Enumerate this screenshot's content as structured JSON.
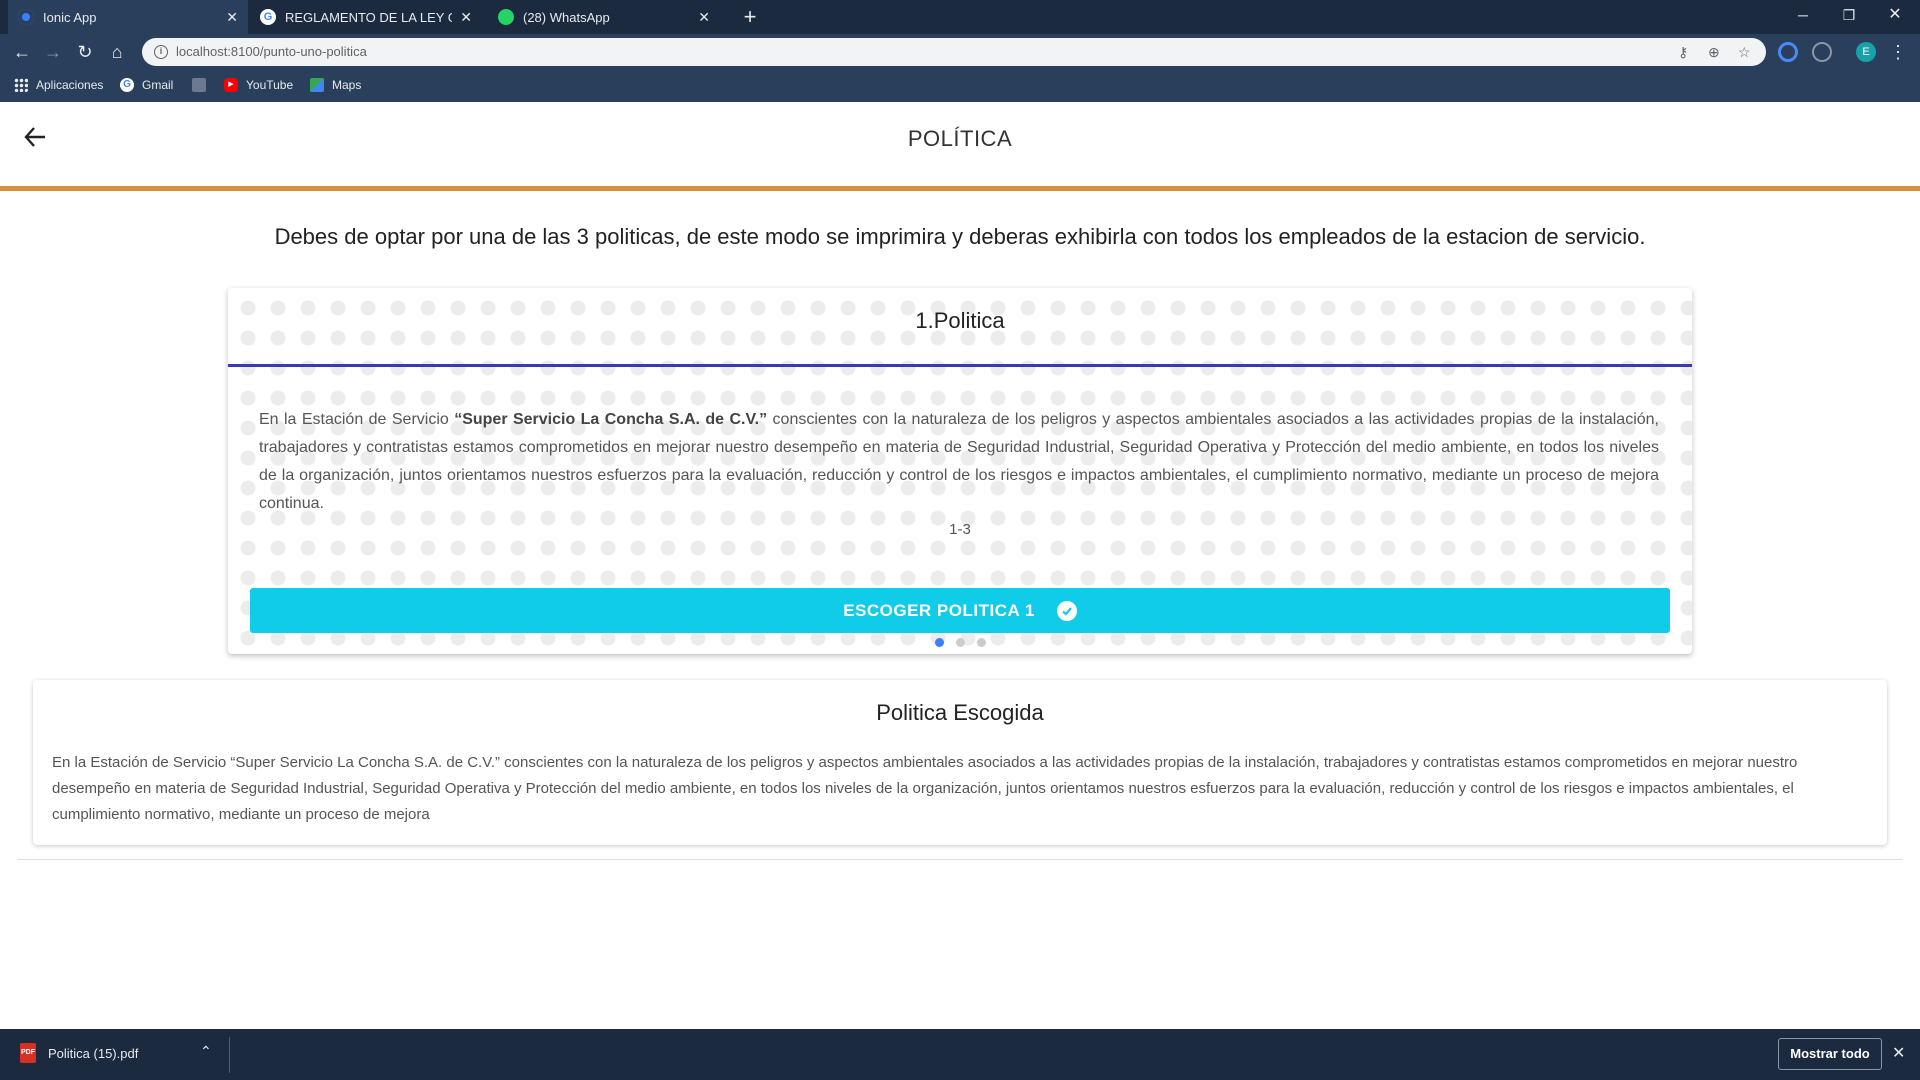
{
  "browser": {
    "tabs": [
      {
        "title": "Ionic App",
        "icon": "ionic-icon",
        "color": "#3880ff"
      },
      {
        "title": "REGLAMENTO DE LA LEY GENERA",
        "icon": "google-icon",
        "color": "#ffffff"
      },
      {
        "title": "(28) WhatsApp",
        "icon": "whatsapp-icon",
        "color": "#25d366"
      }
    ],
    "url": "localhost:8100/punto-uno-politica",
    "profile_initial": "E",
    "bookmarks": [
      {
        "label": "Aplicaciones",
        "icon": "apps-grid-icon"
      },
      {
        "label": "Gmail",
        "icon": "google-icon"
      },
      {
        "label": "",
        "icon": "bookmark-favicon-icon"
      },
      {
        "label": "YouTube",
        "icon": "youtube-icon"
      },
      {
        "label": "Maps",
        "icon": "maps-icon"
      }
    ]
  },
  "header": {
    "title": "POLÍTICA"
  },
  "instructions": "Debes de optar por una de las 3 politicas, de este modo se imprimira y deberas exhibirla con todos los empleados de la estacion de servicio.",
  "policy_card": {
    "title": "1.Politica",
    "text_before": "En la Estación de Servicio ",
    "text_bold": "“Super Servicio La Concha S.A. de C.V.”",
    "text_after": " conscientes con la naturaleza de los peligros y aspectos ambientales asociados a las actividades propias de la instalación, trabajadores y contratistas estamos comprometidos en mejorar nuestro desempeño en materia de Seguridad Industrial, Seguridad Operativa y Protección del medio ambiente, en todos los niveles de la organización, juntos orientamos nuestros esfuerzos para la evaluación, reducción y control de los riesgos e impactos ambientales, el cumplimiento normativo, mediante un proceso de mejora continua.",
    "pager": "1-3",
    "button_label": "ESCOGER POLITICA 1",
    "slide_count": 3,
    "active_slide": 1
  },
  "chosen_card": {
    "title": "Politica Escogida",
    "text": "En la Estación de Servicio “Super Servicio La Concha S.A. de C.V.” conscientes con la naturaleza de los peligros y aspectos ambientales asociados a las actividades propias de la instalación, trabajadores y contratistas estamos comprometidos en mejorar nuestro desempeño en materia de Seguridad Industrial, Seguridad Operativa y Protección del medio ambiente, en todos los niveles de la organización, juntos orientamos nuestros esfuerzos para la evaluación, reducción y control de los riesgos e impactos ambientales, el cumplimiento normativo, mediante un proceso de mejora"
  },
  "downloads": {
    "file_name": "Politica (15).pdf",
    "file_icon_label": "PDF",
    "show_all_label": "Mostrar todo"
  },
  "colors": {
    "accent_orange": "#d68f3c",
    "button_cyan": "#10cce8",
    "rule_blue": "#3a3ab5",
    "browser_dark": "#1b2a3f"
  }
}
